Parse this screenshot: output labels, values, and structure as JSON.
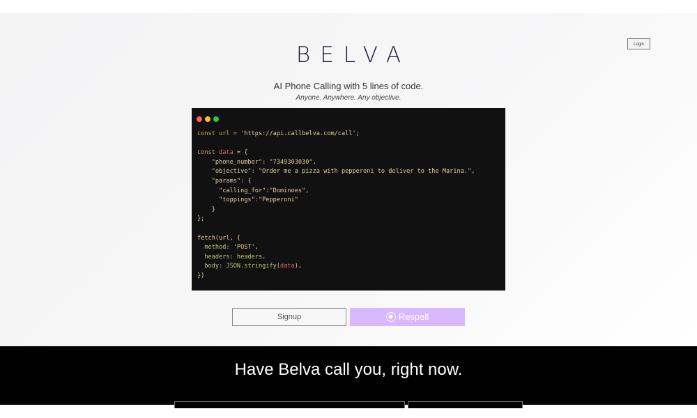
{
  "header": {
    "login_label": "Login",
    "logo_text": "BELVA"
  },
  "hero": {
    "tagline": "AI Phone Calling with 5 lines of code.",
    "subtagline": "Anyone. Anywhere. Any objective."
  },
  "code": {
    "line1_kw": "const url = ",
    "line1_str": "'https://api.callbelva.com/call';",
    "line2_kw": "const ",
    "line2_var": "data",
    "line2_rest": " = {",
    "line3": "    \"phone_number\": \"7349303030\",",
    "line4": "    \"objective\": \"Order me a pizza with pepperoni to deliver to the Marina.\",",
    "line5": "    \"params\": {",
    "line6": "      \"calling_for\":\"Dominoes\",",
    "line7": "      \"toppings\":\"Pepperoni\"",
    "line8": "    }",
    "line9": "};",
    "line10": "fetch(url, {",
    "line11_prop": "  method: ",
    "line11_val": "'POST',",
    "line12_prop": "  headers: ",
    "line12_val": "headers,",
    "line13_prop": "  body: ",
    "line13_fn": "JSON.stringify(",
    "line13_var": "data",
    "line13_end": "),",
    "line14": "})"
  },
  "actions": {
    "signup_label": "Signup",
    "respell_label": "Respell"
  },
  "cta": {
    "title": "Have Belva call you, right now."
  },
  "colors": {
    "accent": "#d9b8ff",
    "code_bg": "#111111",
    "cta_bg": "#000000"
  }
}
